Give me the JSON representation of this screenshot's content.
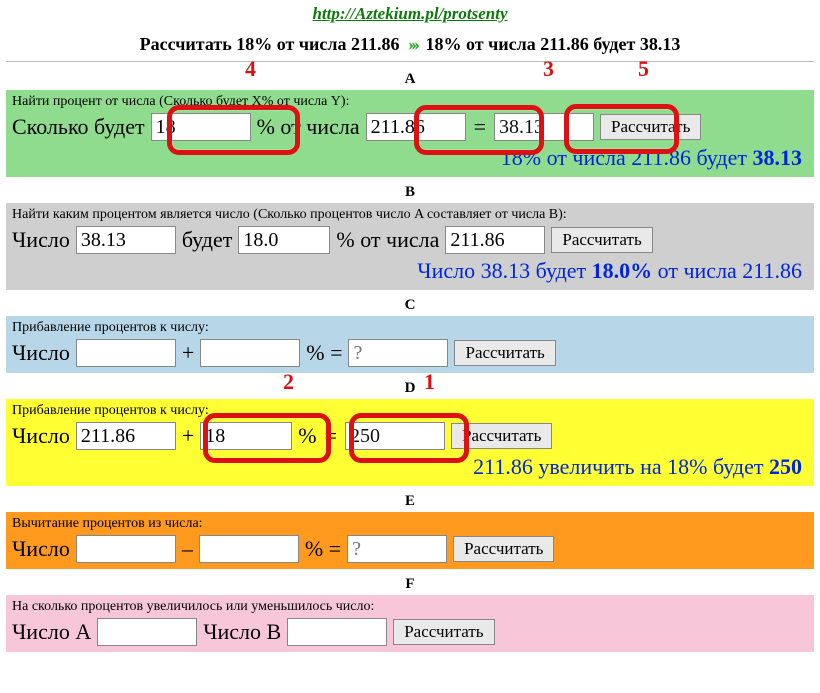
{
  "url": "http://Aztekium.pl/protsenty",
  "headline": {
    "left": "Рассчитать 18% от числа 211.86",
    "right": "18% от числа 211.86 будет 38.13"
  },
  "letters": {
    "A": "A",
    "B": "B",
    "C": "C",
    "D": "D",
    "E": "E",
    "F": "F"
  },
  "buttons": {
    "calc": "Рассчитать"
  },
  "A": {
    "caption": "Найти процент от числа (Сколько будет X% от числа Y):",
    "lbl_prefix": "Сколько будет",
    "lbl_pct": "% от числа",
    "eq": "=",
    "val_percent": "18",
    "val_number": "211.86",
    "val_result": "38.13",
    "result_prefix": "18% от числа 211.86 будет ",
    "result_bold": "38.13"
  },
  "B": {
    "caption": "Найти каким процентом является число (Сколько процентов число A составляет от числа B):",
    "lbl_num": "Число",
    "lbl_budet": "будет",
    "lbl_pct_of": "% от числа",
    "val_a": "38.13",
    "val_pct": "18.0",
    "val_b": "211.86",
    "result_prefix": "Число 38.13 будет ",
    "result_bold": "18.0%",
    "result_suffix": " от числа 211.86"
  },
  "C": {
    "caption": "Прибавление процентов к числу:",
    "lbl_num": "Число",
    "plus": "+",
    "pct_eq": "% =",
    "val_a": "",
    "val_pct": "",
    "result_ph": "?"
  },
  "D": {
    "caption": "Прибавление процентов к числу:",
    "lbl_num": "Число",
    "plus": "+",
    "pct": "%",
    "eq": "=",
    "val_a": "211.86",
    "val_pct": "18",
    "val_result": "250",
    "result_prefix": "211.86 увеличить на 18% будет ",
    "result_bold": "250"
  },
  "E": {
    "caption": "Вычитание процентов из числа:",
    "lbl_num": "Число",
    "minus": "–",
    "pct_eq": "% =",
    "val_a": "",
    "val_pct": "",
    "result_ph": "?"
  },
  "F": {
    "caption": "На сколько процентов увеличилось или уменьшилось число:",
    "lbl_a": "Число A",
    "lbl_b": "Число B",
    "val_a": "",
    "val_b": ""
  },
  "callouts": {
    "1": "1",
    "2": "2",
    "3": "3",
    "4": "4",
    "5": "5"
  }
}
